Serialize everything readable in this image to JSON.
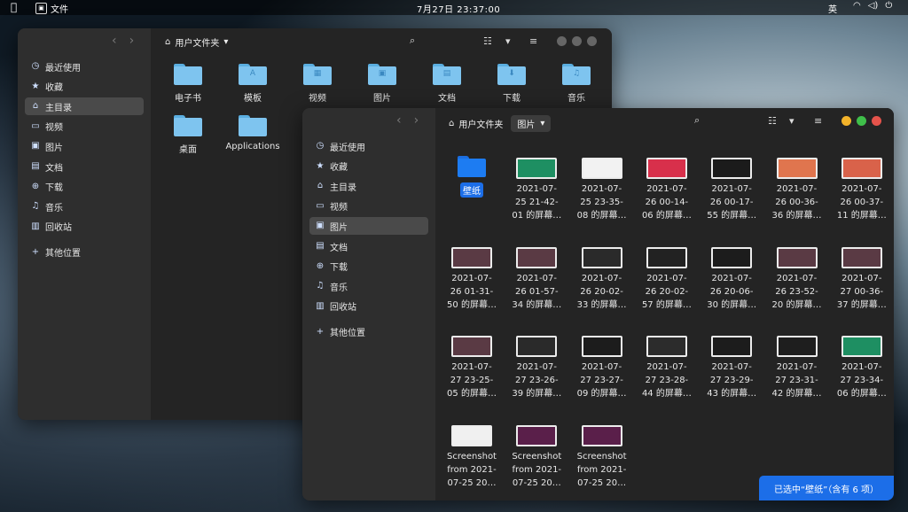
{
  "topbar": {
    "app_name": "文件",
    "clock": "7月27日  23:37:00",
    "ime": "英",
    "tray_icons": [
      "wifi-icon",
      "volume-icon",
      "power-icon"
    ]
  },
  "back_window": {
    "path_label": "用户文件夹",
    "sidebar": [
      {
        "label": "最近使用",
        "icon": "clock-icon"
      },
      {
        "label": "收藏",
        "icon": "star-icon"
      },
      {
        "label": "主目录",
        "icon": "home-icon",
        "active": true
      },
      {
        "label": "视频",
        "icon": "video-icon"
      },
      {
        "label": "图片",
        "icon": "image-icon"
      },
      {
        "label": "文档",
        "icon": "document-icon"
      },
      {
        "label": "下载",
        "icon": "download-icon"
      },
      {
        "label": "音乐",
        "icon": "music-icon"
      },
      {
        "label": "回收站",
        "icon": "trash-icon"
      },
      {
        "label": "其他位置",
        "icon": "plus-icon"
      }
    ],
    "folders": [
      {
        "label": "电子书",
        "glyph": ""
      },
      {
        "label": "模板",
        "glyph": "A"
      },
      {
        "label": "视频",
        "glyph": "▦"
      },
      {
        "label": "图片",
        "glyph": "▣"
      },
      {
        "label": "文档",
        "glyph": "▤"
      },
      {
        "label": "下载",
        "glyph": "⬇"
      },
      {
        "label": "音乐",
        "glyph": "♫"
      },
      {
        "label": "桌面",
        "glyph": ""
      },
      {
        "label": "Applications",
        "glyph": ""
      }
    ]
  },
  "front_window": {
    "path_label": "用户文件夹",
    "current_folder": "图片",
    "sidebar": [
      {
        "label": "最近使用",
        "icon": "clock-icon"
      },
      {
        "label": "收藏",
        "icon": "star-icon"
      },
      {
        "label": "主目录",
        "icon": "home-icon"
      },
      {
        "label": "视频",
        "icon": "video-icon"
      },
      {
        "label": "图片",
        "icon": "image-icon",
        "active": true
      },
      {
        "label": "文档",
        "icon": "document-icon"
      },
      {
        "label": "下载",
        "icon": "download-icon"
      },
      {
        "label": "音乐",
        "icon": "music-icon"
      },
      {
        "label": "回收站",
        "icon": "trash-icon"
      },
      {
        "label": "其他位置",
        "icon": "plus-icon"
      }
    ],
    "selected_folder": "壁纸",
    "files": [
      {
        "label": "2021-07-\n25 21-42-\n01 的屏幕…",
        "thumb": "#1e8f62"
      },
      {
        "label": "2021-07-\n25 23-35-\n08 的屏幕…",
        "thumb": "#f2f2f2"
      },
      {
        "label": "2021-07-\n26 00-14-\n06 的屏幕…",
        "thumb": "#d8304b"
      },
      {
        "label": "2021-07-\n26 00-17-\n55 的屏幕…",
        "thumb": "#1b1b1b"
      },
      {
        "label": "2021-07-\n26 00-36-\n36 的屏幕…",
        "thumb": "#e0754e"
      },
      {
        "label": "2021-07-\n26 00-37-\n11 的屏幕…",
        "thumb": "#d9624a"
      },
      {
        "label": "2021-07-\n26 01-31-\n50 的屏幕…",
        "thumb": "#5a3a44"
      },
      {
        "label": "2021-07-\n26 01-57-\n34 的屏幕…",
        "thumb": "#5a3a44"
      },
      {
        "label": "2021-07-\n26 20-02-\n33 的屏幕…",
        "thumb": "#2a2a2a"
      },
      {
        "label": "2021-07-\n26 20-02-\n57 的屏幕…",
        "thumb": "#222"
      },
      {
        "label": "2021-07-\n26 20-06-\n30 的屏幕…",
        "thumb": "#1c1c1c"
      },
      {
        "label": "2021-07-\n26 23-52-\n20 的屏幕…",
        "thumb": "#5a3a44"
      },
      {
        "label": "2021-07-\n27 00-36-\n37 的屏幕…",
        "thumb": "#5a3a44"
      },
      {
        "label": "2021-07-\n27 23-25-\n05 的屏幕…",
        "thumb": "#5a3a44"
      },
      {
        "label": "2021-07-\n27 23-26-\n39 的屏幕…",
        "thumb": "#2a2a2a"
      },
      {
        "label": "2021-07-\n27 23-27-\n09 的屏幕…",
        "thumb": "#1c1c1c"
      },
      {
        "label": "2021-07-\n27 23-28-\n44 的屏幕…",
        "thumb": "#2c2c2c"
      },
      {
        "label": "2021-07-\n27 23-29-\n43 的屏幕…",
        "thumb": "#1c1c1c"
      },
      {
        "label": "2021-07-\n27 23-31-\n42 的屏幕…",
        "thumb": "#1e1e1e"
      },
      {
        "label": "2021-07-\n27 23-34-\n06 的屏幕…",
        "thumb": "#1e8f62"
      },
      {
        "label": "Screenshot\nfrom 2021-\n07-25 20…",
        "thumb": "#f0f0f0"
      },
      {
        "label": "Screenshot\nfrom 2021-\n07-25 20…",
        "thumb": "#5a1f4a"
      },
      {
        "label": "Screenshot\nfrom 2021-\n07-25 20…",
        "thumb": "#5a1f4a"
      }
    ],
    "status": "已选中“壁纸”（含有 6 项）",
    "colors": {
      "close": "#e5534b",
      "minimize": "#f3b32a",
      "maximize": "#3fbf4a",
      "accent": "#1c6ee8"
    }
  }
}
